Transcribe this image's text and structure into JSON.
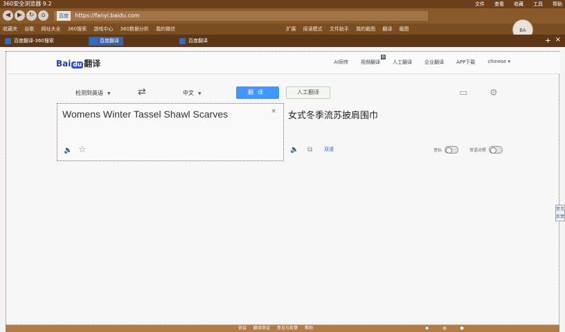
{
  "browser": {
    "window_title": "360安全浏览器 9.2",
    "window_menu": [
      "文件",
      "查看",
      "收藏",
      "工具",
      "帮助"
    ],
    "nav": {
      "back": "◀",
      "forward": "▶",
      "refresh": "↻",
      "home": "⌂"
    },
    "address": {
      "site_label": "百度",
      "url": "https://fanyi.baidu.com"
    },
    "bookmarks": [
      "收藏夹",
      "谷歌",
      "网址大全",
      "360搜索",
      "游戏中心",
      "360数据分析",
      "我的微信",
      "扩展",
      "阅读模式",
      "文件助手",
      "我的截图",
      "翻译",
      "截图"
    ],
    "avatar_label": "BA",
    "tabs": [
      {
        "label": "百度翻译-360搜索",
        "active": false
      },
      {
        "label": "百度翻译",
        "active": true
      },
      {
        "label": "百度翻译",
        "active": false
      }
    ],
    "new_tab": "+",
    "close_tab": "×"
  },
  "header": {
    "logo_pre": "Bai",
    "logo_paw": "du",
    "logo_post": "翻译",
    "nav": [
      {
        "label": "AI同传"
      },
      {
        "label": "视频翻译",
        "badge": "新"
      },
      {
        "label": "人工翻译"
      },
      {
        "label": "企业翻译"
      },
      {
        "label": "APP下载"
      },
      {
        "label": "chinese"
      }
    ]
  },
  "toolbar": {
    "source_lang": "检测到英语",
    "swap_icon": "⇄",
    "target_lang": "中文",
    "translate_label": "翻译",
    "human_label": "人工翻译"
  },
  "source": {
    "text": "Womens Winter Tassel Shawl Scarves",
    "clear_icon": "×",
    "star_icon": "☆",
    "speak_icon": "🔈"
  },
  "target": {
    "text": "女式冬季流苏披肩围巾",
    "speak_icon": "🔈",
    "copy_icon": "⧉",
    "link_label": "双语",
    "switch1_label": "音标",
    "switch2_label": "双语对照"
  },
  "side_feedback": "意见反馈",
  "footer": {
    "links": [
      "协议",
      "翻译协议",
      "意见与反馈",
      "帮助"
    ]
  }
}
